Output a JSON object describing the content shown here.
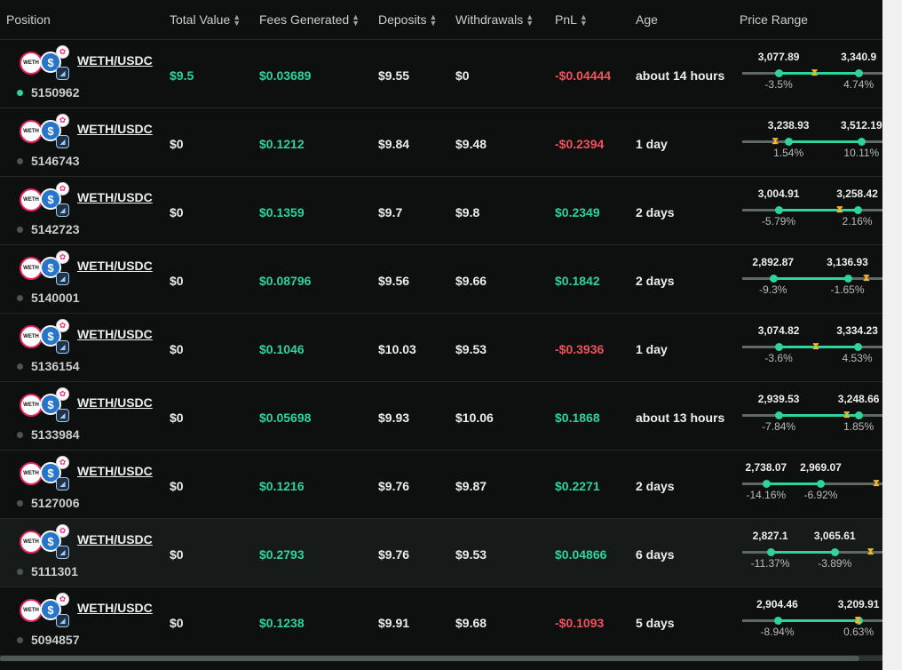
{
  "columns": {
    "position": "Position",
    "total_value": "Total Value",
    "fees": "Fees Generated",
    "deposits": "Deposits",
    "withdrawals": "Withdrawals",
    "pnl": "PnL",
    "age": "Age",
    "price_range": "Price Range"
  },
  "colors": {
    "positive": "#2fd49c",
    "negative": "#f0545a",
    "current_price_marker": "#f2b52b"
  },
  "rows": [
    {
      "pair": "WETH/USDC",
      "id": "5150962",
      "active": true,
      "total_value": "$9.5",
      "total_value_color": "g",
      "fees": "$0.03689",
      "deposits": "$9.55",
      "withdrawals": "$0",
      "pnl": "-$0.04444",
      "pnl_sign": "r",
      "age": "about 14 hours",
      "low": "3,077.89",
      "high": "3,340.9",
      "low_pct": "-3.5%",
      "high_pct": "4.74%",
      "range_position": {
        "low": 0.26,
        "high": 0.83,
        "current": 0.51
      }
    },
    {
      "pair": "WETH/USDC",
      "id": "5146743",
      "active": false,
      "total_value": "$0",
      "total_value_color": "w",
      "fees": "$0.1212",
      "deposits": "$9.84",
      "withdrawals": "$9.48",
      "pnl": "-$0.2394",
      "pnl_sign": "r",
      "age": "1 day",
      "low": "3,238.93",
      "high": "3,512.19",
      "low_pct": "1.54%",
      "high_pct": "10.11%",
      "range_position": {
        "low": 0.33,
        "high": 0.85,
        "current": 0.23
      }
    },
    {
      "pair": "WETH/USDC",
      "id": "5142723",
      "active": false,
      "total_value": "$0",
      "total_value_color": "w",
      "fees": "$0.1359",
      "deposits": "$9.7",
      "withdrawals": "$9.8",
      "pnl": "$0.2349",
      "pnl_sign": "g",
      "age": "2 days",
      "low": "3,004.91",
      "high": "3,258.42",
      "low_pct": "-5.79%",
      "high_pct": "2.16%",
      "range_position": {
        "low": 0.26,
        "high": 0.82,
        "current": 0.69
      }
    },
    {
      "pair": "WETH/USDC",
      "id": "5140001",
      "active": false,
      "total_value": "$0",
      "total_value_color": "w",
      "fees": "$0.08796",
      "deposits": "$9.56",
      "withdrawals": "$9.66",
      "pnl": "$0.1842",
      "pnl_sign": "g",
      "age": "2 days",
      "low": "2,892.87",
      "high": "3,136.93",
      "low_pct": "-9.3%",
      "high_pct": "-1.65%",
      "range_position": {
        "low": 0.22,
        "high": 0.75,
        "current": 0.88
      }
    },
    {
      "pair": "WETH/USDC",
      "id": "5136154",
      "active": false,
      "total_value": "$0",
      "total_value_color": "w",
      "fees": "$0.1046",
      "deposits": "$10.03",
      "withdrawals": "$9.53",
      "pnl": "-$0.3936",
      "pnl_sign": "r",
      "age": "1 day",
      "low": "3,074.82",
      "high": "3,334.23",
      "low_pct": "-3.6%",
      "high_pct": "4.53%",
      "range_position": {
        "low": 0.26,
        "high": 0.82,
        "current": 0.52
      }
    },
    {
      "pair": "WETH/USDC",
      "id": "5133984",
      "active": false,
      "total_value": "$0",
      "total_value_color": "w",
      "fees": "$0.05698",
      "deposits": "$9.93",
      "withdrawals": "$10.06",
      "pnl": "$0.1868",
      "pnl_sign": "g",
      "age": "about 13 hours",
      "low": "2,939.53",
      "high": "3,248.66",
      "low_pct": "-7.84%",
      "high_pct": "1.85%",
      "range_position": {
        "low": 0.26,
        "high": 0.83,
        "current": 0.74
      }
    },
    {
      "pair": "WETH/USDC",
      "id": "5127006",
      "active": false,
      "total_value": "$0",
      "total_value_color": "w",
      "fees": "$0.1216",
      "deposits": "$9.76",
      "withdrawals": "$9.87",
      "pnl": "$0.2271",
      "pnl_sign": "g",
      "age": "2 days",
      "low": "2,738.07",
      "high": "2,969.07",
      "low_pct": "-14.16%",
      "high_pct": "-6.92%",
      "range_position": {
        "low": 0.17,
        "high": 0.56,
        "current": 0.95
      }
    },
    {
      "pair": "WETH/USDC",
      "id": "5111301",
      "active": false,
      "total_value": "$0",
      "total_value_color": "w",
      "fees": "$0.2793",
      "deposits": "$9.76",
      "withdrawals": "$9.53",
      "pnl": "$0.04866",
      "pnl_sign": "g",
      "age": "6 days",
      "low": "2,827.1",
      "high": "3,065.61",
      "low_pct": "-11.37%",
      "high_pct": "-3.89%",
      "range_position": {
        "low": 0.2,
        "high": 0.66,
        "current": 0.91
      }
    },
    {
      "pair": "WETH/USDC",
      "id": "5094857",
      "active": false,
      "total_value": "$0",
      "total_value_color": "w",
      "fees": "$0.1238",
      "deposits": "$9.91",
      "withdrawals": "$9.68",
      "pnl": "-$0.1093",
      "pnl_sign": "r",
      "age": "5 days",
      "low": "2,904.46",
      "high": "3,209.91",
      "low_pct": "-8.94%",
      "high_pct": "0.63%",
      "range_position": {
        "low": 0.25,
        "high": 0.83,
        "current": 0.82
      }
    }
  ]
}
